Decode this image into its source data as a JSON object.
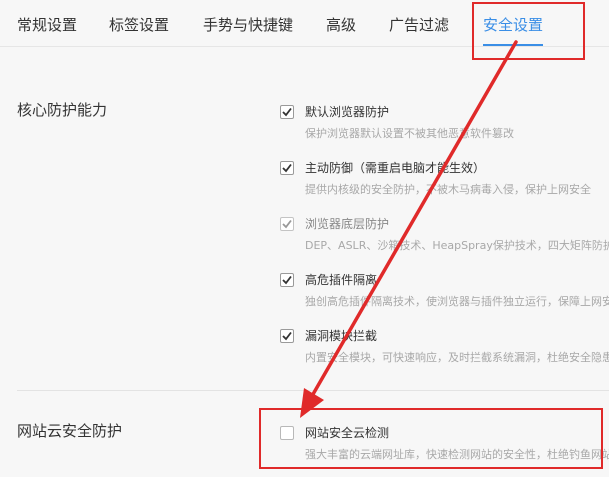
{
  "tabs": [
    {
      "label": "常规设置",
      "active": false
    },
    {
      "label": "标签设置",
      "active": false
    },
    {
      "label": "手势与快捷键",
      "active": false
    },
    {
      "label": "高级",
      "active": false
    },
    {
      "label": "广告过滤",
      "active": false
    },
    {
      "label": "安全设置",
      "active": true
    }
  ],
  "sections": {
    "core": {
      "title": "核心防护能力",
      "options": [
        {
          "label": "默认浏览器防护",
          "desc": "保护浏览器默认设置不被其他恶意软件篡改",
          "checked": true,
          "dim": false
        },
        {
          "label": "主动防御（需重启电脑才能生效）",
          "desc": "提供内核级的安全防护，不被木马病毒入侵，保护上网安全",
          "checked": true,
          "dim": false
        },
        {
          "label": "浏览器底层防护",
          "desc": "DEP、ASLR、沙箱技术、HeapSpray保护技术，四大矩阵防护",
          "checked": true,
          "dim": true
        },
        {
          "label": "高危插件隔离",
          "desc": "独创高危插件隔离技术，使浏览器与插件独立运行，保障上网安全",
          "checked": true,
          "dim": false
        },
        {
          "label": "漏洞模块拦截",
          "desc": "内置安全模块，可快速响应，及时拦截系统漏洞，杜绝安全隐患",
          "checked": true,
          "dim": false
        }
      ]
    },
    "cloud": {
      "title": "网站云安全防护",
      "options": [
        {
          "label": "网站安全云检测",
          "desc": "强大丰富的云端网址库，快速检测网站的安全性，杜绝钓鱼网站",
          "checked": false,
          "dim": false
        }
      ]
    }
  },
  "colors": {
    "accent": "#3a8ee6",
    "highlight": "#e02a2a"
  }
}
